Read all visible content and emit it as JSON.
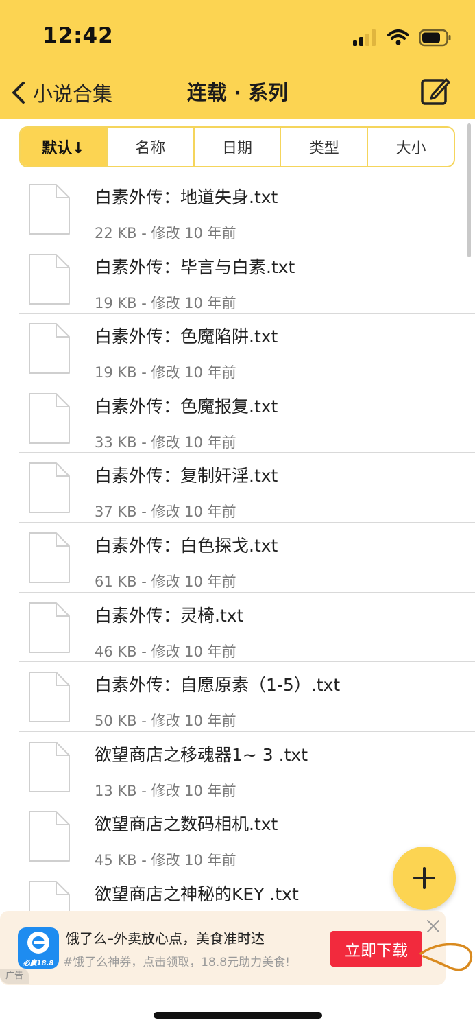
{
  "status_bar": {
    "time": "12:42"
  },
  "nav": {
    "back_label": "小说合集",
    "title": "连载 · 系列"
  },
  "sort_tabs": [
    {
      "label": "默认↓",
      "active": true
    },
    {
      "label": "名称",
      "active": false
    },
    {
      "label": "日期",
      "active": false
    },
    {
      "label": "类型",
      "active": false
    },
    {
      "label": "大小",
      "active": false
    }
  ],
  "files": [
    {
      "name": "白素外传：地道失身.txt",
      "meta": "22 KB - 修改 10 年前"
    },
    {
      "name": "白素外传：毕言与白素.txt",
      "meta": "19 KB - 修改 10 年前"
    },
    {
      "name": "白素外传：色魔陷阱.txt",
      "meta": "19 KB - 修改 10 年前"
    },
    {
      "name": "白素外传：色魔报复.txt",
      "meta": "33 KB - 修改 10 年前"
    },
    {
      "name": "白素外传：复制奸淫.txt",
      "meta": "37 KB - 修改 10 年前"
    },
    {
      "name": "白素外传：白色探戈.txt",
      "meta": "61 KB - 修改 10 年前"
    },
    {
      "name": "白素外传：灵椅.txt",
      "meta": "46 KB - 修改 10 年前"
    },
    {
      "name": "白素外传：自愿原素（1-5）.txt",
      "meta": "50 KB - 修改 10 年前"
    },
    {
      "name": "欲望商店之移魂器1~ 3 .txt",
      "meta": "13 KB - 修改 10 年前"
    },
    {
      "name": "欲望商店之数码相机.txt",
      "meta": "45 KB - 修改 10 年前"
    },
    {
      "name": "欲望商店之神秘的KEY .txt",
      "meta": ""
    }
  ],
  "ad": {
    "logo_text": "必赢18.8",
    "title": "饿了么–外卖放心点，美食准时达",
    "subtitle": "#饿了么神券，点击领取，18.8元助力美食!",
    "cta": "立即下载",
    "tag": "广告"
  },
  "colors": {
    "accent": "#FCD452",
    "cta": "#F22A3D",
    "ad_bg": "#FBF0E2"
  },
  "icons": [
    "back-chevron-icon",
    "edit-icon",
    "file-icon",
    "plus-icon",
    "close-icon",
    "signal-icon",
    "wifi-icon",
    "battery-icon"
  ]
}
